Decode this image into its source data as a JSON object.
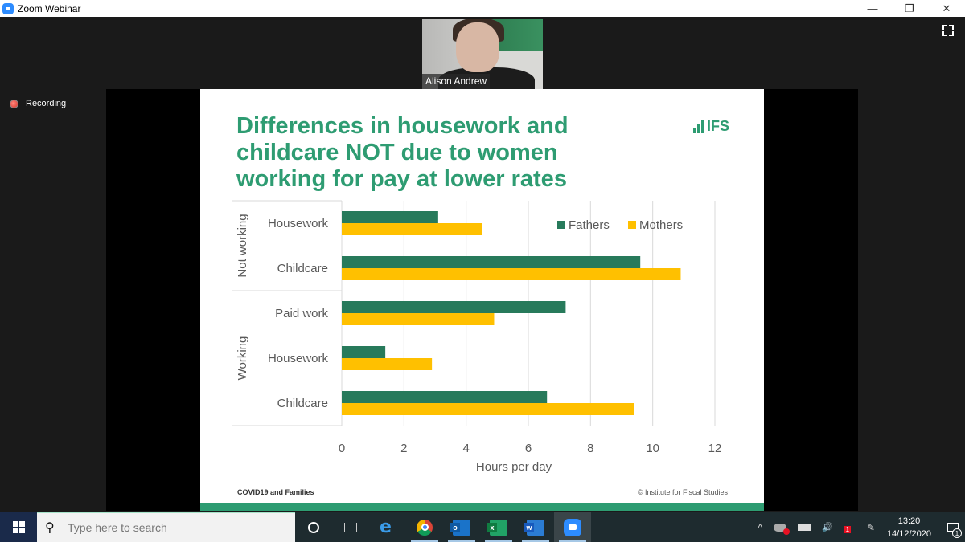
{
  "window": {
    "app_title": "Zoom Webinar",
    "controls": {
      "minimize": "—",
      "restore": "❐",
      "close": "✕"
    }
  },
  "meeting": {
    "speaker_name": "Alison Andrew",
    "recording_label": "Recording",
    "fullscreen_icon": "fullscreen-icon"
  },
  "slide": {
    "title": "Differences in housework and childcare NOT due to women working for pay at lower rates",
    "logo_text": "IFS",
    "footer_left": "COVID19 and Families",
    "footer_right": "© Institute for Fiscal Studies",
    "colors": {
      "accent": "#2e9c72",
      "fathers": "#277a5b",
      "mothers": "#ffc000"
    }
  },
  "chart_data": {
    "type": "bar",
    "orientation": "horizontal",
    "title": "",
    "xlabel": "Hours per day",
    "ylabel": "",
    "xlim": [
      0,
      12
    ],
    "xticks": [
      "0",
      "2",
      "4",
      "6",
      "8",
      "10",
      "12"
    ],
    "grid": true,
    "legend_position": "top-right",
    "groups": [
      {
        "label": "Not working",
        "categories": [
          "Housework",
          "Childcare"
        ]
      },
      {
        "label": "Working",
        "categories": [
          "Paid work",
          "Housework",
          "Childcare"
        ]
      }
    ],
    "categories": [
      "Housework",
      "Childcare",
      "Paid work",
      "Housework",
      "Childcare"
    ],
    "series": [
      {
        "name": "Fathers",
        "color": "#277a5b",
        "values": [
          3.1,
          9.6,
          7.2,
          1.4,
          6.6
        ]
      },
      {
        "name": "Mothers",
        "color": "#ffc000",
        "values": [
          4.5,
          10.9,
          4.9,
          2.9,
          9.4
        ]
      }
    ]
  },
  "taskbar": {
    "search_placeholder": "Type here to search",
    "apps": [
      "cortana",
      "task-view",
      "edge",
      "chrome",
      "outlook",
      "excel",
      "word",
      "zoom"
    ],
    "app_letters": {
      "outlook": "o",
      "excel": "x",
      "word": "w"
    },
    "tray": {
      "chevron": "^",
      "volume": "🔊",
      "dropbox_badge": "1"
    },
    "time": "13:20",
    "date": "14/12/2020",
    "notification_count": "1"
  }
}
